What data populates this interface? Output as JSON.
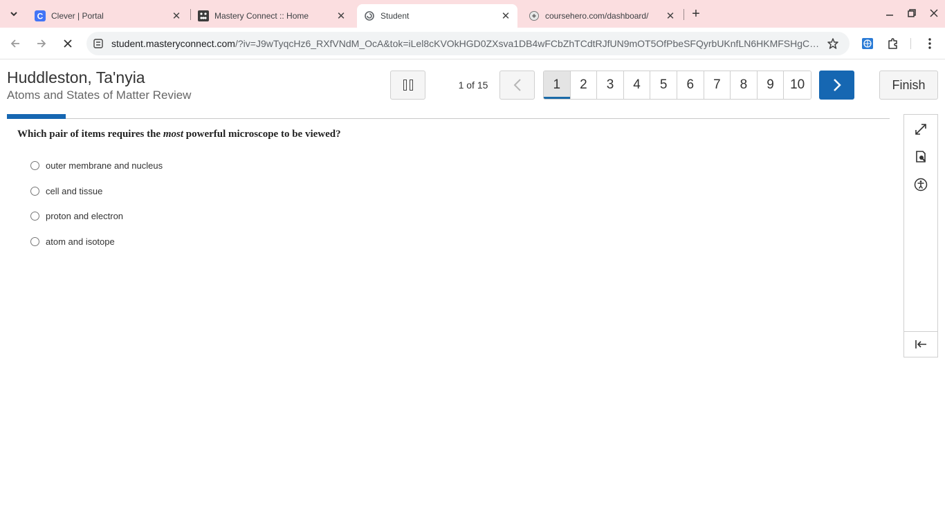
{
  "browser": {
    "tabs": [
      {
        "title": "Clever | Portal",
        "icon": "clever-icon",
        "active": false
      },
      {
        "title": "Mastery Connect :: Home",
        "icon": "mastery-connect-icon",
        "active": false
      },
      {
        "title": "Student",
        "icon": "loading-icon",
        "active": true
      },
      {
        "title": "coursehero.com/dashboard/",
        "icon": "globe-icon",
        "active": false
      }
    ],
    "url_host": "student.masteryconnect.com",
    "url_rest": "/?iv=J9wTyqcHz6_RXfVNdM_OcA&tok=iLel8cKVOkHGD0ZXsva1DB4wFCbZhTCdtRJfUN9mOT5OfPbeSFQyrbUKnfLN6HKMFSHgCP..."
  },
  "header": {
    "student_name": "Huddleston, Ta'nyia",
    "assessment_name": "Atoms and States of Matter Review",
    "progress_text": "1 of 15",
    "question_numbers": [
      "1",
      "2",
      "3",
      "4",
      "5",
      "6",
      "7",
      "8",
      "9",
      "10"
    ],
    "current_question": 1,
    "total_questions": 15,
    "finish_label": "Finish"
  },
  "question": {
    "text_before": "Which pair of items requires the ",
    "text_emphasis": "most",
    "text_after": " powerful microscope to be viewed?",
    "choices": [
      "outer membrane and nucleus",
      "cell and tissue",
      "proton and electron",
      "atom and isotope"
    ]
  },
  "tools": [
    "expand-icon",
    "magnifier-icon",
    "accessibility-icon",
    "collapse-panel-icon"
  ],
  "colors": {
    "accent": "#1667b2",
    "tabbar": "#fbdee0"
  }
}
